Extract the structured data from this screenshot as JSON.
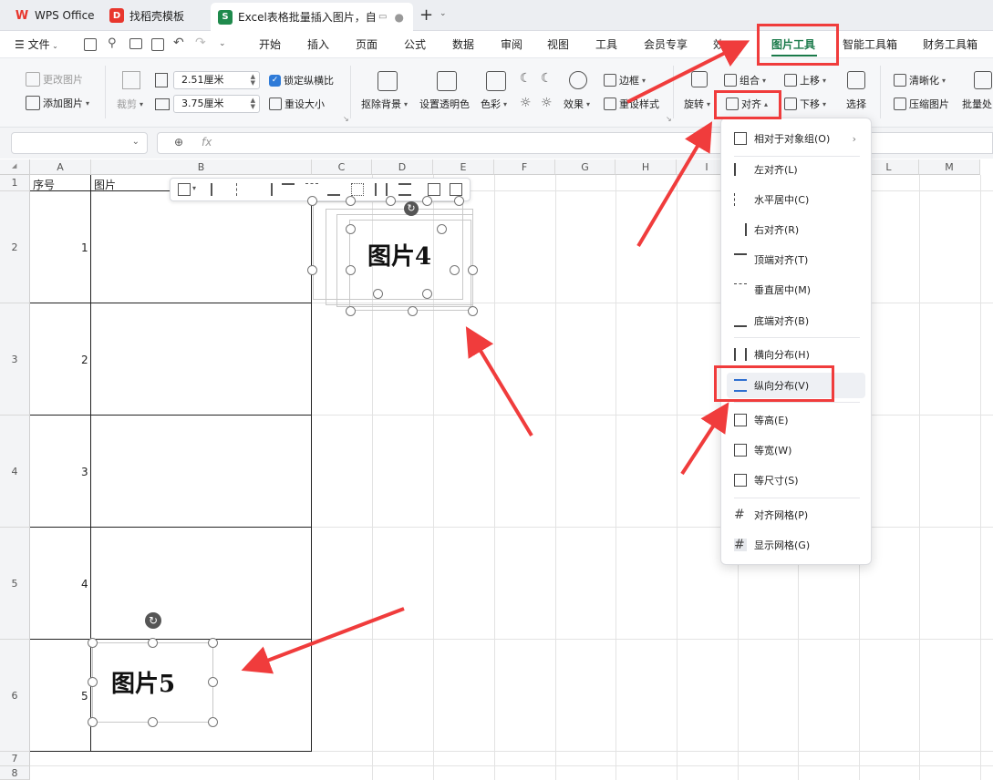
{
  "tabs": [
    {
      "label": "WPS Office",
      "icon": "wps-logo-icon"
    },
    {
      "label": "找稻壳模板",
      "icon": "docer-icon"
    },
    {
      "label": "Excel表格批量插入图片，自动",
      "icon": "sheet-icon"
    }
  ],
  "menu": {
    "file": "文件",
    "items": [
      "开始",
      "插入",
      "页面",
      "公式",
      "数据",
      "审阅",
      "视图",
      "工具",
      "会员专享",
      "效",
      "图片工具",
      "智能工具箱",
      "财务工具箱"
    ]
  },
  "ribbon": {
    "change_picture": "更改图片",
    "add_picture": "添加图片",
    "crop": "裁剪",
    "height_value": "2.51厘米",
    "width_value": "3.75厘米",
    "lock_ratio": "锁定纵横比",
    "reset_size": "重设大小",
    "remove_bg": "抠除背景",
    "set_transparent": "设置透明色",
    "color": "色彩",
    "effects": "效果",
    "border": "边框",
    "reset_style": "重设样式",
    "rotate": "旋转",
    "group": "组合",
    "align": "对齐",
    "bring_up": "上移",
    "send_down": "下移",
    "select": "选择",
    "sharpen": "清晰化",
    "compress": "压缩图片",
    "batch": "批量处"
  },
  "formula": {
    "fx": "fx"
  },
  "columns": [
    "A",
    "B",
    "C",
    "D",
    "E",
    "F",
    "G",
    "H",
    "I",
    "J",
    "K",
    "L",
    "M"
  ],
  "rows": [
    "1",
    "2",
    "3",
    "4",
    "5",
    "6",
    "7",
    "8"
  ],
  "cells": {
    "a1": "序号",
    "b1": "图片",
    "a2": "1",
    "a3": "2",
    "a4": "3",
    "a5": "4",
    "a6": "5"
  },
  "images": {
    "picture4": "图片4",
    "picture5": "图片5"
  },
  "dropdown": {
    "items": [
      {
        "label": "相对于对象组(O)"
      },
      {
        "label": "左对齐(L)"
      },
      {
        "label": "水平居中(C)"
      },
      {
        "label": "右对齐(R)"
      },
      {
        "label": "顶端对齐(T)"
      },
      {
        "label": "垂直居中(M)"
      },
      {
        "label": "底端对齐(B)"
      },
      {
        "label": "横向分布(H)"
      },
      {
        "label": "纵向分布(V)"
      },
      {
        "label": "等高(E)"
      },
      {
        "label": "等宽(W)"
      },
      {
        "label": "等尺寸(S)"
      },
      {
        "label": "对齐网格(P)"
      },
      {
        "label": "显示网格(G)"
      }
    ]
  },
  "colors": {
    "accent": "#1a7a4a",
    "annotation": "#f03c3c",
    "wps_red": "#e8362d",
    "sheet_green": "#1f8a4c"
  }
}
